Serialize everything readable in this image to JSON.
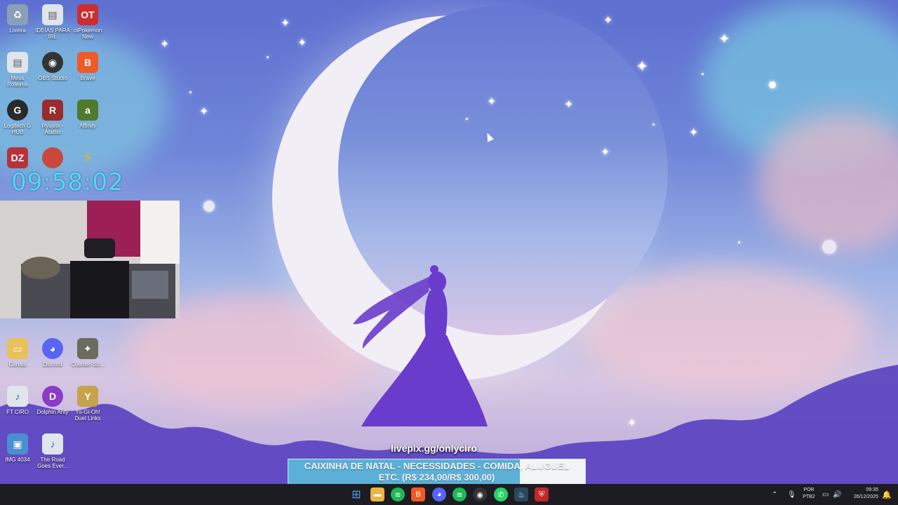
{
  "desktop": {
    "icons": [
      {
        "label": "Lixeira",
        "glyph": "♻",
        "color": "#8aa0b8"
      },
      {
        "label": "IDEIAS PARA IRL",
        "glyph": "▤",
        "color": "#dfe5ea"
      },
      {
        "label": "otPokemon New",
        "glyph": "OT",
        "color": "#cc2e2e"
      },
      {
        "label": "Meus Roteiros",
        "glyph": "▤",
        "color": "#dfe5ea"
      },
      {
        "label": "OBS Studio",
        "glyph": "◉",
        "color": "#333333"
      },
      {
        "label": "Brave",
        "glyph": "B",
        "color": "#f05a24"
      },
      {
        "label": "Logitech G HUB",
        "glyph": "G",
        "color": "#2a2a2a"
      },
      {
        "label": "Ryujinx - Atalho",
        "glyph": "R",
        "color": "#9b2c2c"
      },
      {
        "label": "Affinity",
        "glyph": "a",
        "color": "#4f7a2c"
      },
      {
        "label": "Canais",
        "glyph": "▭",
        "color": "#e8c15a"
      },
      {
        "label": "Discord",
        "glyph": "◕",
        "color": "#5865f2"
      },
      {
        "label": "Counter-Str...",
        "glyph": "✦",
        "color": "#6b6b5e"
      },
      {
        "label": "FT CIRO",
        "glyph": "♪",
        "color": "#dfe5ea"
      },
      {
        "label": "Dolphin Anty",
        "glyph": "D",
        "color": "#8a3cc8"
      },
      {
        "label": "Yu-Gi-Oh! Duel Links",
        "glyph": "Y",
        "color": "#c6a24a"
      },
      {
        "label": "IMG 4034",
        "glyph": "▣",
        "color": "#4a90d0"
      },
      {
        "label": "The Road Goes Ever...",
        "glyph": "♪",
        "color": "#dfe5ea"
      }
    ]
  },
  "overlay": {
    "clock": "09:58:02",
    "stream_url": "livepix.gg/onlyciro",
    "donation_line1": "CAIXINHA DE NATAL - NECESSIDADES - COMIDA, ALUGUEL",
    "donation_line2": "ETC. (R$ 234,00/R$ 300,00)",
    "donation_progress": 0.78
  },
  "taskbar": {
    "apps": [
      {
        "name": "start",
        "glyph": "⊞",
        "color": "#1c1c22"
      },
      {
        "name": "explorer",
        "glyph": "▬",
        "color": "#e8b443"
      },
      {
        "name": "spotify",
        "glyph": "≋",
        "color": "#1db954"
      },
      {
        "name": "brave",
        "glyph": "B",
        "color": "#f05a24"
      },
      {
        "name": "discord",
        "glyph": "◕",
        "color": "#5865f2"
      },
      {
        "name": "spotify",
        "glyph": "≋",
        "color": "#1db954"
      },
      {
        "name": "obs",
        "glyph": "◉",
        "color": "#333333"
      },
      {
        "name": "whatsapp",
        "glyph": "✆",
        "color": "#25d366"
      },
      {
        "name": "steam",
        "glyph": "♨",
        "color": "#2a475e"
      },
      {
        "name": "shield",
        "glyph": "⛨",
        "color": "#c02828"
      }
    ],
    "lang_top": "POR",
    "lang_bottom": "PTB2",
    "time": "09:35",
    "date": "26/12/2025"
  }
}
